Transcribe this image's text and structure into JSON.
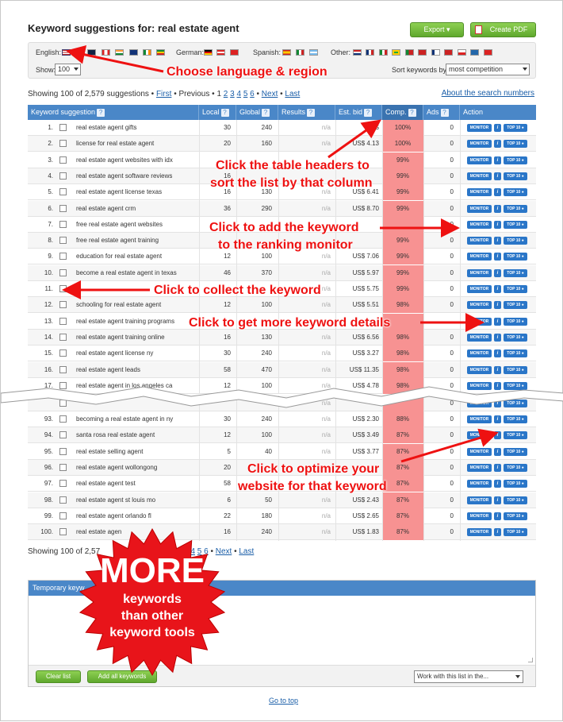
{
  "header": {
    "title": "Keyword suggestions for: real estate agent",
    "export_label": "Export ▾",
    "create_pdf_label": "Create PDF"
  },
  "settings": {
    "english_label": "English:",
    "german_label": "German:",
    "spanish_label": "Spanish:",
    "other_label": "Other:",
    "show_label": "Show:",
    "show_value": "100",
    "sort_label": "Sort keywords by:",
    "sort_value": "most competition"
  },
  "pagination_top": {
    "showing": "Showing 100 of 2,579 suggestions •",
    "first": "First",
    "previous": "• Previous •",
    "pages": [
      "1",
      "2",
      "3",
      "4",
      "5",
      "6"
    ],
    "next": "Next",
    "last": "Last"
  },
  "pagination_bottom": {
    "showing": "Showing 100 of 2,57",
    "pages": [
      "2",
      "3",
      "4",
      "5",
      "6"
    ],
    "next": "Next",
    "last": "Last"
  },
  "about_link": "About the search numbers",
  "table": {
    "headers": [
      "Keyword suggestion",
      "Local",
      "Global",
      "Results",
      "Est. bid",
      "Comp.",
      "Ads",
      "Action"
    ],
    "monitor_label": "MONITOR",
    "info_label": "i",
    "top10_label": "TOP 10 ●",
    "rows": [
      {
        "n": "1.",
        "kw": "real estate agent gifts",
        "local": "30",
        "global": "240",
        "results": "n/a",
        "bid": "US",
        "comp": "100%",
        "ads": "0"
      },
      {
        "n": "2.",
        "kw": "license for real estate agent",
        "local": "20",
        "global": "160",
        "results": "n/a",
        "bid": "US$ 4.13",
        "comp": "100%",
        "ads": "0"
      },
      {
        "n": "3.",
        "kw": "real estate agent websites with idx",
        "local": "",
        "global": "",
        "results": "",
        "bid": "",
        "comp": "99%",
        "ads": "0"
      },
      {
        "n": "4.",
        "kw": "real estate agent software reviews",
        "local": "16",
        "global": "",
        "results": "",
        "bid": "",
        "comp": "99%",
        "ads": "0"
      },
      {
        "n": "5.",
        "kw": "real estate agent license texas",
        "local": "16",
        "global": "130",
        "results": "n/a",
        "bid": "US$ 6.41",
        "comp": "99%",
        "ads": "0"
      },
      {
        "n": "6.",
        "kw": "real estate agent crm",
        "local": "36",
        "global": "290",
        "results": "n/a",
        "bid": "US$ 8.70",
        "comp": "99%",
        "ads": "0"
      },
      {
        "n": "7.",
        "kw": "free real estate agent websites",
        "local": "",
        "global": "",
        "results": "",
        "bid": "",
        "comp": "",
        "ads": "0"
      },
      {
        "n": "8.",
        "kw": "free real estate agent training",
        "local": "",
        "global": "",
        "results": "",
        "bid": "",
        "comp": "99%",
        "ads": "0"
      },
      {
        "n": "9.",
        "kw": "education for real estate agent",
        "local": "12",
        "global": "100",
        "results": "n/a",
        "bid": "US$ 7.06",
        "comp": "99%",
        "ads": "0"
      },
      {
        "n": "10.",
        "kw": "become a real estate agent in texas",
        "local": "46",
        "global": "370",
        "results": "n/a",
        "bid": "US$ 5.97",
        "comp": "99%",
        "ads": "0"
      },
      {
        "n": "11.",
        "kw": "",
        "local": "",
        "global": "",
        "results": "n/a",
        "bid": "US$ 5.75",
        "comp": "99%",
        "ads": "0"
      },
      {
        "n": "12.",
        "kw": "schooling for real estate agent",
        "local": "12",
        "global": "100",
        "results": "n/a",
        "bid": "US$ 5.51",
        "comp": "98%",
        "ads": "0"
      },
      {
        "n": "13.",
        "kw": "real estate agent training programs",
        "local": "",
        "global": "",
        "results": "",
        "bid": "",
        "comp": "",
        "ads": ""
      },
      {
        "n": "14.",
        "kw": "real estate agent training online",
        "local": "16",
        "global": "130",
        "results": "n/a",
        "bid": "US$ 6.56",
        "comp": "98%",
        "ads": "0"
      },
      {
        "n": "15.",
        "kw": "real estate agent license ny",
        "local": "30",
        "global": "240",
        "results": "n/a",
        "bid": "US$ 3.27",
        "comp": "98%",
        "ads": "0"
      },
      {
        "n": "16.",
        "kw": "real estate agent leads",
        "local": "58",
        "global": "470",
        "results": "n/a",
        "bid": "US$ 11.35",
        "comp": "98%",
        "ads": "0"
      },
      {
        "n": "17.",
        "kw": "real estate agent in los angeles ca",
        "local": "12",
        "global": "100",
        "results": "n/a",
        "bid": "US$ 4.78",
        "comp": "98%",
        "ads": "0"
      },
      {
        "n": "",
        "kw": "",
        "local": "",
        "global": "",
        "results": "n/a",
        "bid": "",
        "comp": "",
        "ads": "0"
      },
      {
        "n": "93.",
        "kw": "becoming a real estate agent in ny",
        "local": "30",
        "global": "240",
        "results": "n/a",
        "bid": "US$ 2.30",
        "comp": "88%",
        "ads": "0"
      },
      {
        "n": "94.",
        "kw": "santa rosa real estate agent",
        "local": "12",
        "global": "100",
        "results": "n/a",
        "bid": "US$ 3.49",
        "comp": "87%",
        "ads": "0"
      },
      {
        "n": "95.",
        "kw": "real estate selling agent",
        "local": "5",
        "global": "40",
        "results": "n/a",
        "bid": "US$ 3.77",
        "comp": "87%",
        "ads": "0"
      },
      {
        "n": "96.",
        "kw": "real estate agent wollongong",
        "local": "20",
        "global": "",
        "results": "",
        "bid": "",
        "comp": "87%",
        "ads": "0"
      },
      {
        "n": "97.",
        "kw": "real estate agent test",
        "local": "58",
        "global": "",
        "results": "",
        "bid": "",
        "comp": "87%",
        "ads": "0"
      },
      {
        "n": "98.",
        "kw": "real estate agent st louis mo",
        "local": "6",
        "global": "50",
        "results": "n/a",
        "bid": "US$ 2.43",
        "comp": "87%",
        "ads": "0"
      },
      {
        "n": "99.",
        "kw": "real estate agent orlando fl",
        "local": "22",
        "global": "180",
        "results": "n/a",
        "bid": "US$ 2.65",
        "comp": "87%",
        "ads": "0"
      },
      {
        "n": "100.",
        "kw": "real estate agen",
        "local": "16",
        "global": "240",
        "results": "n/a",
        "bid": "US$ 1.83",
        "comp": "87%",
        "ads": "0"
      }
    ]
  },
  "annotations": {
    "language": "Choose language & region",
    "headers_1": "Click the table headers to",
    "headers_2": "sort the list by that column",
    "monitor_1": "Click to add the keyword",
    "monitor_2": "to the ranking monitor",
    "collect": "Click to collect the keyword",
    "details": "Click to get more keyword details",
    "optimize_1": "Click to optimize your",
    "optimize_2": "website for that keyword"
  },
  "badge": {
    "line1": "MORE",
    "line2": "keywords",
    "line3": "than other",
    "line4": "keyword tools"
  },
  "temp_list": {
    "header": "Temporary keyw",
    "clear_label": "Clear list",
    "add_all_label": "Add all keywords",
    "work_with_value": "Work with this list in the..."
  },
  "goto_top": "Go to top",
  "colors": {
    "accent_blue": "#4a87c8",
    "comp_red": "#f79292",
    "annotation_red": "#ee1111",
    "green_button": "#6cb83a"
  }
}
